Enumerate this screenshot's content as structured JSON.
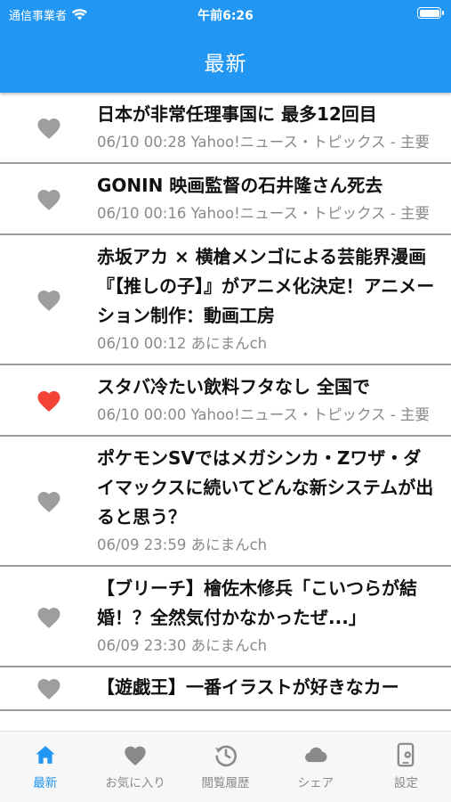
{
  "status_bar": {
    "carrier": "通信事業者",
    "time": "午前6:26"
  },
  "header": {
    "title": "最新"
  },
  "colors": {
    "primary": "#2196f3",
    "favorite_on": "#f44336",
    "favorite_off": "#9e9e9e"
  },
  "articles": [
    {
      "title": "日本が非常任理事国に 最多12回目",
      "meta": "06/10 00:28 Yahoo!ニュース・トピックス - 主要",
      "favorited": false
    },
    {
      "title": "GONIN 映画監督の石井隆さん死去",
      "meta": "06/10 00:16 Yahoo!ニュース・トピックス - 主要",
      "favorited": false
    },
    {
      "title": "赤坂アカ × 横槍メンゴによる芸能界漫画『【推しの子】』がアニメ化決定！アニメーション制作：動画工房",
      "meta": "06/10 00:12 あにまんch",
      "favorited": false
    },
    {
      "title": "スタバ冷たい飲料フタなし 全国で",
      "meta": "06/10 00:00 Yahoo!ニュース・トピックス - 主要",
      "favorited": true
    },
    {
      "title": "ポケモンSVではメガシンカ・Zワザ・ダイマックスに続いてどんな新システムが出ると思う？",
      "meta": "06/09 23:59 あにまんch",
      "favorited": false
    },
    {
      "title": "【ブリーチ】檜佐木修兵「こいつらが結婚！？全然気付かなかったぜ...」",
      "meta": "06/09 23:30 あにまんch",
      "favorited": false
    },
    {
      "title": "【遊戯王】一番イラストが好きなカー",
      "meta": "",
      "favorited": false
    }
  ],
  "tabs": [
    {
      "label": "最新",
      "icon": "home-icon",
      "active": true
    },
    {
      "label": "お気に入り",
      "icon": "heart-icon",
      "active": false
    },
    {
      "label": "閲覧履歴",
      "icon": "history-icon",
      "active": false
    },
    {
      "label": "シェア",
      "icon": "cloud-icon",
      "active": false
    },
    {
      "label": "設定",
      "icon": "settings-icon",
      "active": false
    }
  ]
}
